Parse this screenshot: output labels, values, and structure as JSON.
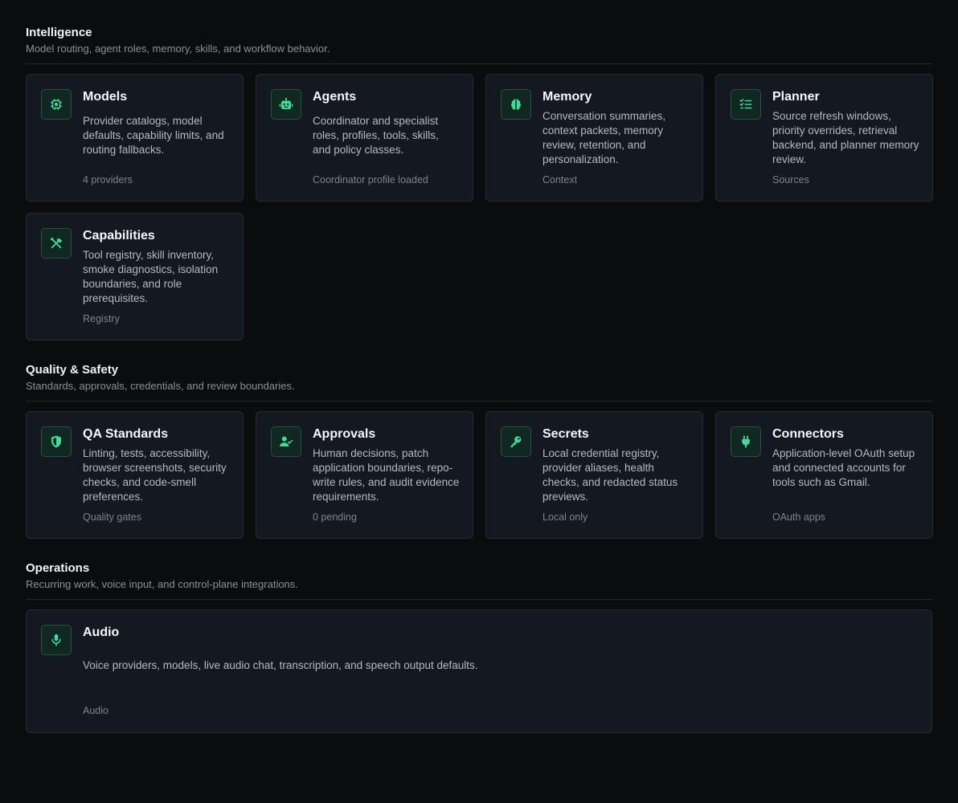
{
  "colors": {
    "background": "#0b0c0e",
    "card": "#141820",
    "accent": "#3ddc97"
  },
  "sections": [
    {
      "title": "Intelligence",
      "subtitle": "Model routing, agent roles, memory, skills, and workflow behavior.",
      "cards": [
        {
          "icon": "chip-icon",
          "title": "Models",
          "description": "Provider catalogs, model defaults, capability limits, and routing fallbacks.",
          "footer": "4 providers"
        },
        {
          "icon": "robot-icon",
          "title": "Agents",
          "description": "Coordinator and specialist roles, profiles, tools, skills, and policy classes.",
          "footer": "Coordinator profile loaded"
        },
        {
          "icon": "brain-icon",
          "title": "Memory",
          "description": "Conversation summaries, context packets, memory review, retention, and personalization.",
          "footer": "Context"
        },
        {
          "icon": "checklist-icon",
          "title": "Planner",
          "description": "Source refresh windows, priority overrides, retrieval backend, and planner memory review.",
          "footer": "Sources"
        },
        {
          "icon": "tools-icon",
          "title": "Capabilities",
          "description": "Tool registry, skill inventory, smoke diagnostics, isolation boundaries, and role prerequisites.",
          "footer": "Registry"
        }
      ]
    },
    {
      "title": "Quality & Safety",
      "subtitle": "Standards, approvals, credentials, and review boundaries.",
      "cards": [
        {
          "icon": "shield-icon",
          "title": "QA Standards",
          "description": "Linting, tests, accessibility, browser screenshots, security checks, and code-smell preferences.",
          "footer": "Quality gates"
        },
        {
          "icon": "user-check-icon",
          "title": "Approvals",
          "description": "Human decisions, patch application boundaries, repo-write rules, and audit evidence requirements.",
          "footer": "0 pending"
        },
        {
          "icon": "key-icon",
          "title": "Secrets",
          "description": "Local credential registry, provider aliases, health checks, and redacted status previews.",
          "footer": "Local only"
        },
        {
          "icon": "plug-icon",
          "title": "Connectors",
          "description": "Application-level OAuth setup and connected accounts for tools such as Gmail.",
          "footer": "OAuth apps"
        }
      ]
    },
    {
      "title": "Operations",
      "subtitle": "Recurring work, voice input, and control-plane integrations.",
      "cards": [
        {
          "icon": "microphone-icon",
          "title": "Audio",
          "description": "Voice providers, models, live audio chat, transcription, and speech output defaults.",
          "footer": "Audio"
        }
      ]
    }
  ]
}
